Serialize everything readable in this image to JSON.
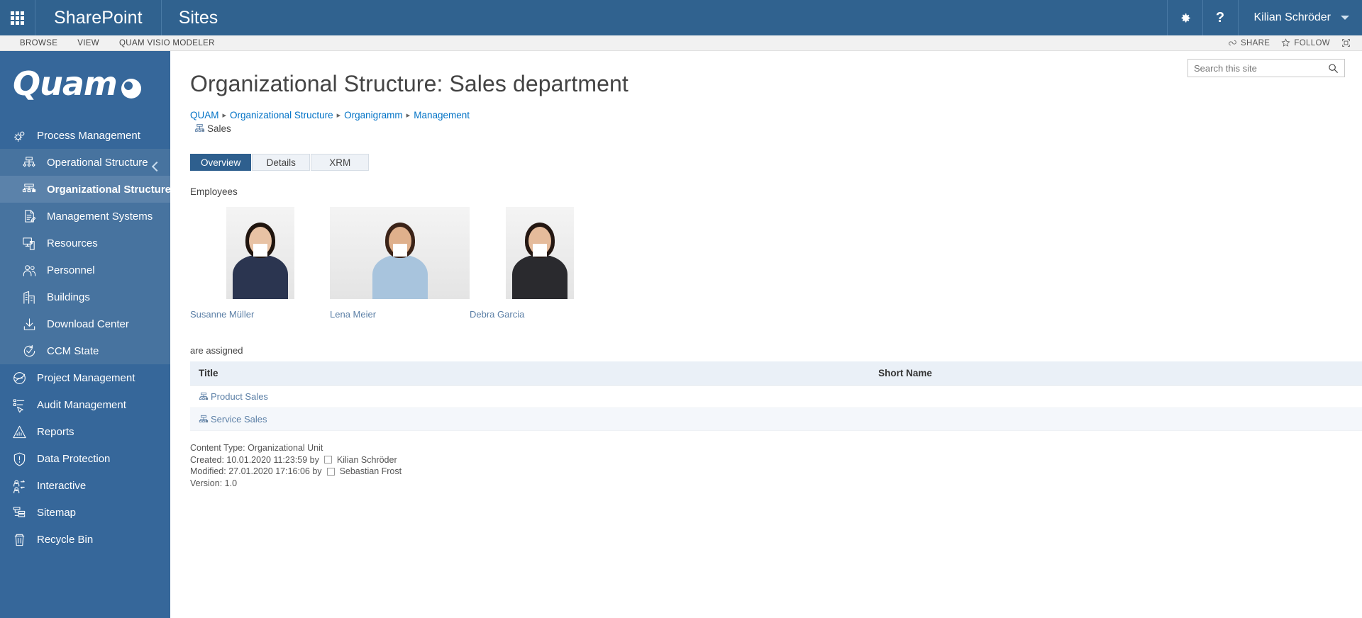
{
  "suite": {
    "waffle_icon": "app-launcher-icon",
    "brand": "SharePoint",
    "site": "Sites",
    "settings_icon": "gear-icon",
    "help_icon": "help-icon",
    "user": "Kilian Schröder"
  },
  "ribbon": {
    "tabs": [
      "BROWSE",
      "VIEW",
      "QUAM VISIO MODELER"
    ],
    "share": "SHARE",
    "follow": "FOLLOW",
    "focus_icon": "focus-on-content-icon"
  },
  "sidebar": {
    "logo": "Quam",
    "collapse_icon": "chevron-left-icon",
    "items": [
      {
        "label": "Process Management",
        "icon": "gears-icon",
        "level": 0,
        "active": false
      },
      {
        "label": "Operational Structure",
        "icon": "flowchart-icon",
        "level": 1,
        "active": false
      },
      {
        "label": "Organizational Structure",
        "icon": "org-chart-icon",
        "level": 1,
        "active": true
      },
      {
        "label": "Management Systems",
        "icon": "document-edit-icon",
        "level": 1,
        "active": false
      },
      {
        "label": "Resources",
        "icon": "resources-icon",
        "level": 1,
        "active": false
      },
      {
        "label": "Personnel",
        "icon": "people-icon",
        "level": 1,
        "active": false
      },
      {
        "label": "Buildings",
        "icon": "buildings-icon",
        "level": 1,
        "active": false
      },
      {
        "label": "Download Center",
        "icon": "download-icon",
        "level": 1,
        "active": false
      },
      {
        "label": "CCM State",
        "icon": "check-cycle-icon",
        "level": 1,
        "active": false
      },
      {
        "label": "Project Management",
        "icon": "globe-icon",
        "level": 0,
        "active": false
      },
      {
        "label": "Audit Management",
        "icon": "checklist-cursor-icon",
        "level": 0,
        "active": false
      },
      {
        "label": "Reports",
        "icon": "chart-triangle-icon",
        "level": 0,
        "active": false
      },
      {
        "label": "Data Protection",
        "icon": "shield-alert-icon",
        "level": 0,
        "active": false
      },
      {
        "label": "Interactive",
        "icon": "people-exchange-icon",
        "level": 0,
        "active": false
      },
      {
        "label": "Sitemap",
        "icon": "sitemap-icon",
        "level": 0,
        "active": false
      },
      {
        "label": "Recycle Bin",
        "icon": "trash-icon",
        "level": 0,
        "active": false
      }
    ]
  },
  "search": {
    "placeholder": "Search this site",
    "value": "",
    "icon": "search-icon"
  },
  "page": {
    "title": "Organizational Structure: Sales department",
    "breadcrumb": [
      "QUAM",
      "Organizational Structure",
      "Organigramm",
      "Management"
    ],
    "breadcrumb_leaf": "Sales",
    "leaf_icon": "org-unit-icon"
  },
  "tabs": [
    {
      "label": "Overview",
      "active": true
    },
    {
      "label": "Details",
      "active": false
    },
    {
      "label": "XRM",
      "active": false
    }
  ],
  "employees_section": {
    "label": "Employees",
    "items": [
      {
        "name": "Susanne Müller",
        "hair": "#20150f",
        "skin": "#e8c2a4",
        "cloth": "#2b3550",
        "wide": false
      },
      {
        "name": "Lena Meier",
        "hair": "#3b2318",
        "skin": "#dfb08c",
        "cloth": "#a8c4dd",
        "wide": true
      },
      {
        "name": "Debra Garcia",
        "hair": "#241712",
        "skin": "#e5bb9b",
        "cloth": "#2a2a2e",
        "wide": false
      }
    ]
  },
  "assigned": {
    "label": "are assigned",
    "columns": [
      "Title",
      "Short Name"
    ],
    "rows": [
      {
        "title": "Product Sales",
        "short_name": "",
        "icon": "org-unit-icon"
      },
      {
        "title": "Service Sales",
        "short_name": "",
        "icon": "org-unit-icon"
      }
    ]
  },
  "meta": {
    "content_type_label": "Content Type: Organizational Unit",
    "created_prefix": "Created: 10.01.2020 11:23:59 by",
    "created_by": "Kilian Schröder",
    "modified_prefix": "Modified: 27.01.2020 17:16:06 by",
    "modified_by": "Sebastian Frost",
    "version": "Version: 1.0"
  },
  "colors": {
    "suite_bar": "#30628f",
    "sidebar": "#36679a",
    "sidebar_sub": "#47739f",
    "sidebar_active": "#5b82aa",
    "tab_active": "#2e5f8e",
    "link": "#0072c6",
    "table_header": "#eaf0f7"
  }
}
